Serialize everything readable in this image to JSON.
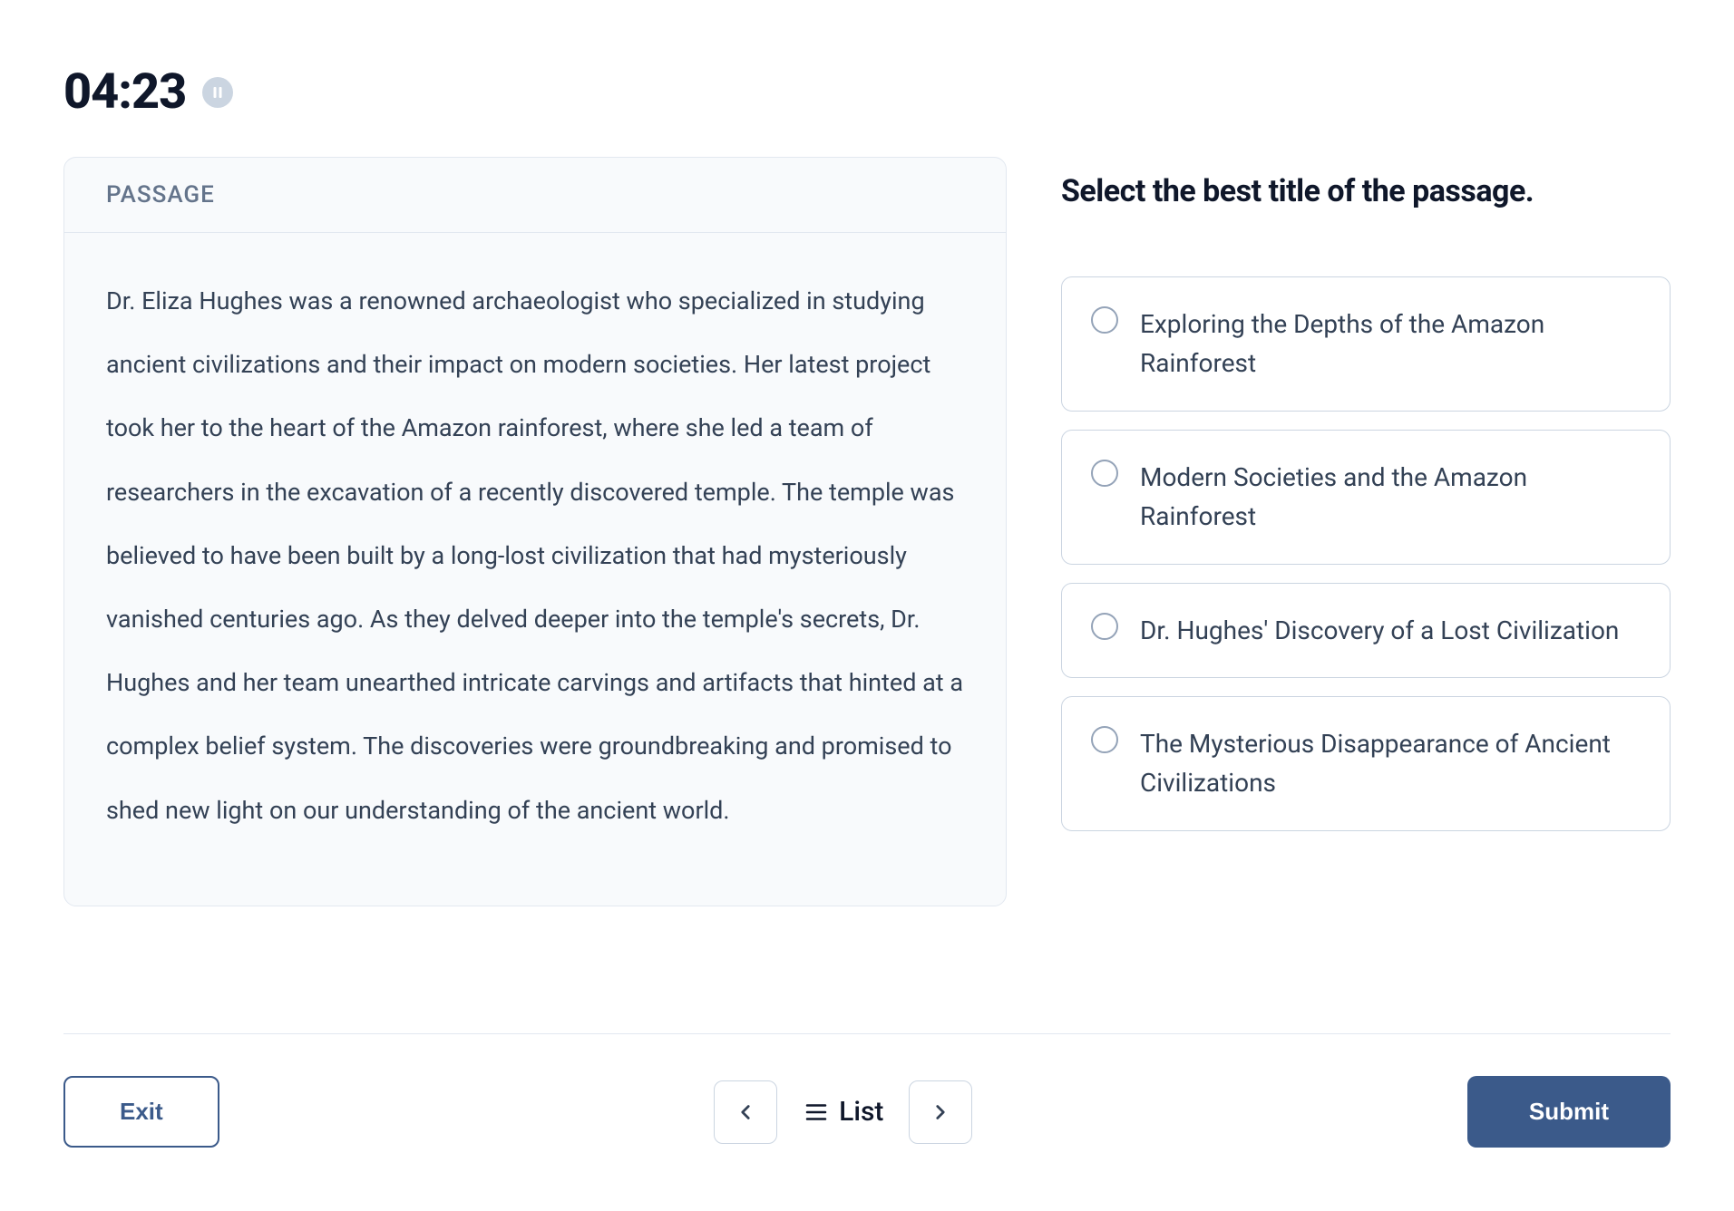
{
  "timer": "04:23",
  "passage": {
    "label": "PASSAGE",
    "text": "Dr. Eliza Hughes was a renowned archaeologist who specialized in studying ancient civilizations and their impact on modern societies. Her latest project took her to the heart of the Amazon rainforest, where she led a team of researchers in the excavation of a recently discovered temple. The temple was believed to have been built by a long-lost civilization that had mysteriously vanished centuries ago. As they delved deeper into the temple's secrets, Dr. Hughes and her team unearthed intricate carvings and artifacts that hinted at a complex belief system. The discoveries were groundbreaking and promised to shed new light on our understanding of the ancient world."
  },
  "question": {
    "prompt": "Select the best title of the passage.",
    "options": [
      "Exploring the Depths of the Amazon Rainforest",
      "Modern Societies and the Amazon Rainforest",
      "Dr. Hughes' Discovery of a Lost Civilization",
      "The Mysterious Disappearance of Ancient Civilizations"
    ]
  },
  "footer": {
    "exit": "Exit",
    "list": "List",
    "submit": "Submit"
  }
}
